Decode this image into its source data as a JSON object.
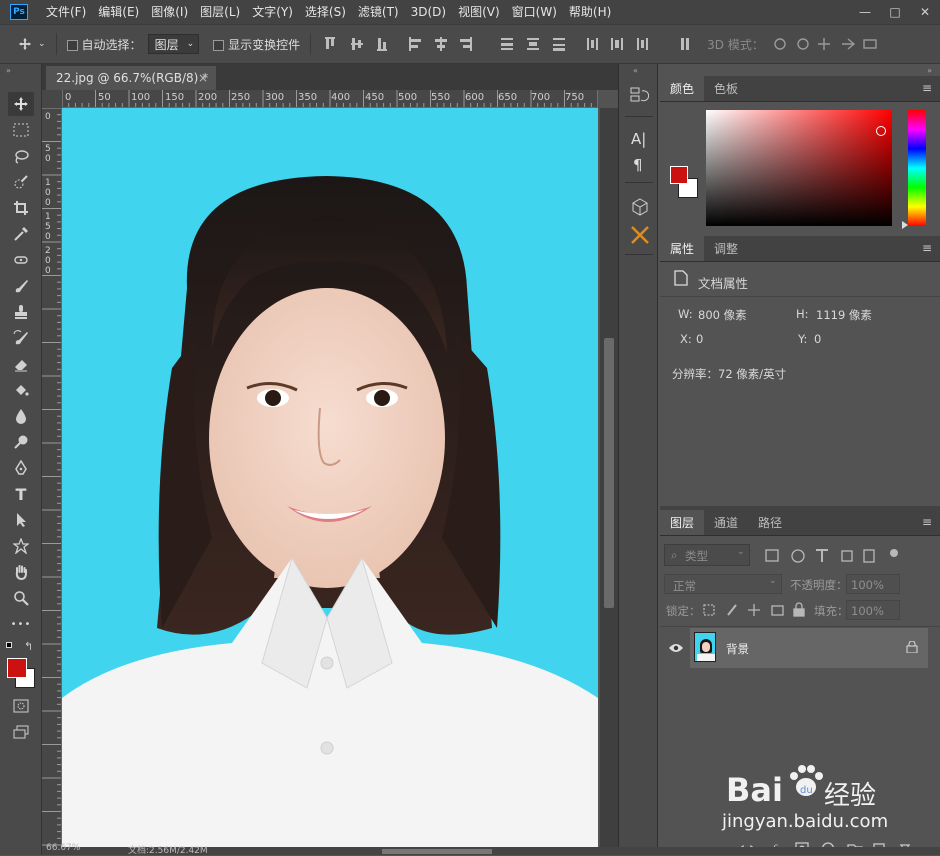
{
  "app": {
    "logo": "Ps"
  },
  "menu": [
    "文件(F)",
    "编辑(E)",
    "图像(I)",
    "图层(L)",
    "文字(Y)",
    "选择(S)",
    "滤镜(T)",
    "3D(D)",
    "视图(V)",
    "窗口(W)",
    "帮助(H)"
  ],
  "window_controls": [
    "—",
    "□",
    "✕"
  ],
  "options": {
    "auto_select_label": "自动选择：",
    "auto_select_value": "图层",
    "show_transform_label": "显示变换控件",
    "mode_3d_label": "3D 模式："
  },
  "document": {
    "tab_title": "22.jpg @ 66.7%(RGB/8) *",
    "tab_close": "×",
    "ruler_ticks": [
      "0",
      "50",
      "100",
      "150",
      "200",
      "250",
      "300",
      "350",
      "400",
      "450",
      "500",
      "550",
      "600",
      "650",
      "700",
      "750"
    ],
    "ruler_v_ticks": [
      "0",
      "5",
      "0",
      "1",
      "0",
      "0",
      "1",
      "5",
      "0",
      "2",
      "0",
      "0"
    ],
    "status": {
      "zoom": "66.67%",
      "doc_size": "文档:2.56M/2.42M"
    }
  },
  "color_panel": {
    "tabs": [
      "颜色",
      "色板"
    ],
    "foreground": "#cc1111",
    "background": "#ffffff"
  },
  "properties_panel": {
    "tabs": [
      "属性",
      "调整"
    ],
    "title": "文档属性",
    "w_label": "W:",
    "w_value": "800 像素",
    "h_label": "H:",
    "h_value": "1119 像素",
    "x_label": "X:",
    "x_value": "0",
    "y_label": "Y:",
    "y_value": "0",
    "resolution": "分辨率：72 像素/英寸"
  },
  "layers_panel": {
    "tabs": [
      "图层",
      "通道",
      "路径"
    ],
    "filter_label": "类型",
    "blend_mode": "正常",
    "opacity_label": "不透明度：",
    "opacity_value": "100%",
    "lock_label": "锁定：",
    "fill_label": "填充：",
    "fill_value": "100%",
    "layers": [
      {
        "name": "背景",
        "visible": true,
        "locked": true
      }
    ],
    "bottom_icons": [
      "link-icon",
      "fx-icon",
      "mask-icon",
      "adjustment-icon",
      "folder-icon",
      "new-layer-icon",
      "trash-icon"
    ],
    "fx_label": "fx"
  },
  "tools": [
    "move-tool-icon",
    "marquee-tool-icon",
    "lasso-tool-icon",
    "quick-select-tool-icon",
    "crop-tool-icon",
    "eyedropper-tool-icon",
    "healing-tool-icon",
    "brush-tool-icon",
    "stamp-tool-icon",
    "history-brush-tool-icon",
    "eraser-tool-icon",
    "paint-bucket-tool-icon",
    "blur-tool-icon",
    "dodge-tool-icon",
    "pen-tool-icon",
    "type-tool-icon",
    "path-select-tool-icon",
    "shape-tool-icon",
    "hand-tool-icon",
    "zoom-tool-icon",
    "more-tools-icon"
  ],
  "type_tool_glyph": "T",
  "more_tools_glyph": "•••",
  "watermark": {
    "brand": "Bai",
    "brand2": "经验",
    "url": "jingyan.baidu.com"
  },
  "colors": {
    "canvas_bg": "#40d4ee",
    "ui_dark": "#434343",
    "ui_mid": "#535353"
  }
}
